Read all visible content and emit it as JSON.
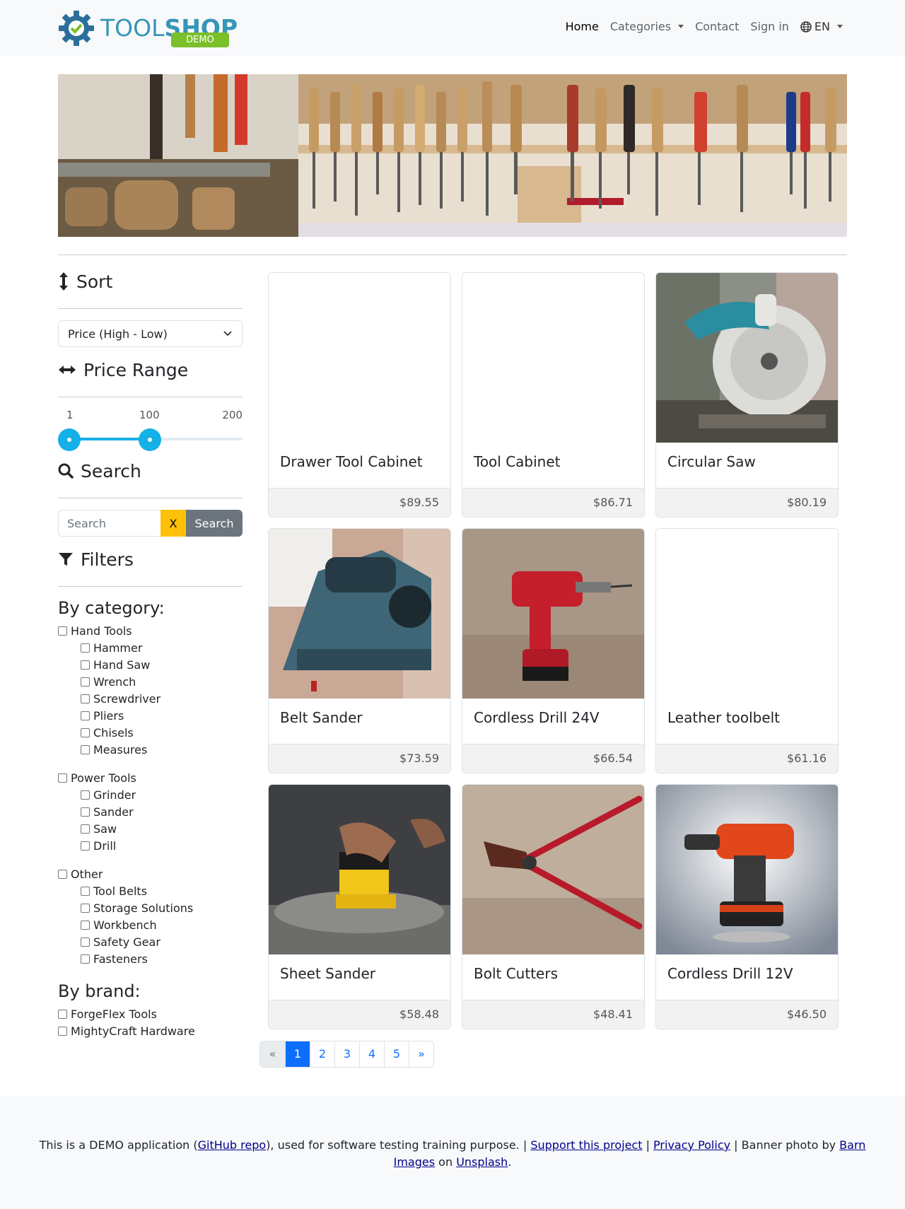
{
  "navbar": {
    "logo_text_a": "TOOL",
    "logo_text_b": "SHOP",
    "logo_badge": "DEMO",
    "links": [
      {
        "label": "Home",
        "active": true
      },
      {
        "label": "Categories",
        "dropdown": true
      },
      {
        "label": "Contact"
      },
      {
        "label": "Sign in"
      },
      {
        "label": "EN",
        "dropdown": true,
        "icon": "globe-icon"
      }
    ]
  },
  "sidebar": {
    "sort_title": "Sort",
    "sort_value": "Price (High - Low)",
    "price_title": "Price Range",
    "price_min_label": "1",
    "price_current_label": "100",
    "price_max_label": "200",
    "price_range": {
      "min": 1,
      "max": 200,
      "low": 1,
      "high": 100
    },
    "search_title": "Search",
    "search_placeholder": "Search",
    "search_clear": "X",
    "search_button": "Search",
    "filters_title": "Filters",
    "by_category": "By category:",
    "categories": [
      {
        "label": "Hand Tools",
        "children": [
          "Hammer",
          "Hand Saw",
          "Wrench",
          "Screwdriver",
          "Pliers",
          "Chisels",
          "Measures"
        ]
      },
      {
        "label": "Power Tools",
        "children": [
          "Grinder",
          "Sander",
          "Saw",
          "Drill"
        ]
      },
      {
        "label": "Other",
        "children": [
          "Tool Belts",
          "Storage Solutions",
          "Workbench",
          "Safety Gear",
          "Fasteners"
        ]
      }
    ],
    "by_brand": "By brand:",
    "brands": [
      "ForgeFlex Tools",
      "MightyCraft Hardware"
    ]
  },
  "products": [
    {
      "name": "Drawer Tool Cabinet",
      "price": "$89.55",
      "image": "none"
    },
    {
      "name": "Tool Cabinet",
      "price": "$86.71",
      "image": "none"
    },
    {
      "name": "Circular Saw",
      "price": "$80.19",
      "image": "circular-saw"
    },
    {
      "name": "Belt Sander",
      "price": "$73.59",
      "image": "belt-sander"
    },
    {
      "name": "Cordless Drill 24V",
      "price": "$66.54",
      "image": "cordless-drill-red"
    },
    {
      "name": "Leather toolbelt",
      "price": "$61.16",
      "image": "none"
    },
    {
      "name": "Sheet Sander",
      "price": "$58.48",
      "image": "sheet-sander"
    },
    {
      "name": "Bolt Cutters",
      "price": "$48.41",
      "image": "bolt-cutters"
    },
    {
      "name": "Cordless Drill 12V",
      "price": "$46.50",
      "image": "cordless-drill-orange"
    }
  ],
  "pagination": {
    "prev": "«",
    "pages": [
      "1",
      "2",
      "3",
      "4",
      "5"
    ],
    "active": "1",
    "next": "»"
  },
  "footer": {
    "text_1": "This is a DEMO application (",
    "link_github": "GitHub repo",
    "text_2": "), used for software testing training purpose. | ",
    "link_support": "Support this project",
    "text_3": " | ",
    "link_privacy": "Privacy Policy",
    "text_4": " | Banner photo by ",
    "link_barn": "Barn Images",
    "text_5": " on ",
    "link_unsplash": "Unsplash",
    "text_6": "."
  },
  "colors": {
    "accent": "#0d6efd",
    "slider": "#14b0e8",
    "clear_button": "#ffc107",
    "search_button": "#6c757d",
    "logo": "#3596b8",
    "logo_badge": "#7bbf2a"
  }
}
